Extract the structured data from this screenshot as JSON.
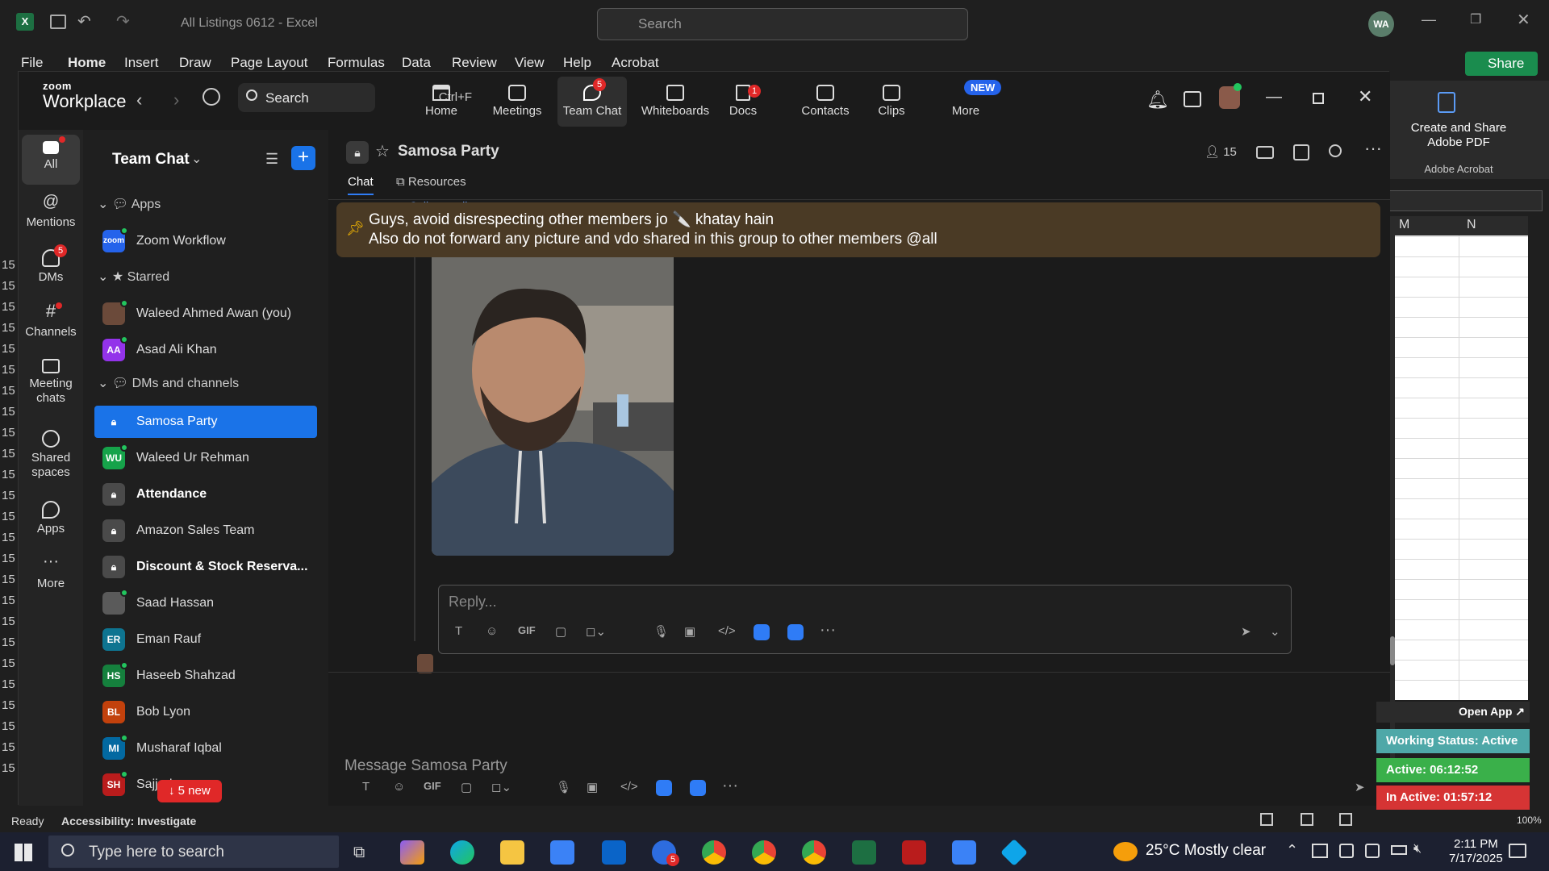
{
  "excel": {
    "title": "All Listings 0612  -  Excel",
    "search_placeholder": "Search",
    "avatar": "WA",
    "share_label": "Share",
    "tabs": [
      "File",
      "Home",
      "Insert",
      "Draw",
      "Page Layout",
      "Formulas",
      "Data",
      "Review",
      "View",
      "Help",
      "Acrobat"
    ],
    "acrobat_create": "Create and Share Adobe PDF",
    "acrobat_group": "Adobe Acrobat",
    "col_m": "M",
    "col_n": "N",
    "row_label": "15",
    "status_ready": "Ready",
    "status_accessibility": "Accessibility: Investigate",
    "zoom_level": "100%"
  },
  "zoom": {
    "logo_top": "zoom",
    "logo_bottom": "Workplace",
    "search_label": "Search",
    "search_shortcut": "Ctrl+F",
    "nav": [
      {
        "label": "Home",
        "icon": "home-icon"
      },
      {
        "label": "Meetings",
        "icon": "camera-icon"
      },
      {
        "label": "Team Chat",
        "icon": "chat-icon",
        "badge": "5"
      },
      {
        "label": "Whiteboards",
        "icon": "whiteboard-icon"
      },
      {
        "label": "Docs",
        "icon": "docs-icon",
        "badge": "1"
      },
      {
        "label": "Contacts",
        "icon": "contacts-icon"
      },
      {
        "label": "Clips",
        "icon": "clips-icon"
      },
      {
        "label": "More",
        "icon": "more-icon",
        "pill": "NEW"
      }
    ],
    "rail": [
      {
        "label": "All",
        "icon": "chat-bubble-icon"
      },
      {
        "label": "Mentions",
        "icon": "at-icon"
      },
      {
        "label": "DMs",
        "icon": "people-icon",
        "badge": "5"
      },
      {
        "label": "Channels",
        "icon": "hash-icon"
      },
      {
        "label": "Meeting chats",
        "icon": "calendar-icon"
      },
      {
        "label": "Shared spaces",
        "icon": "share-icon"
      },
      {
        "label": "Apps",
        "icon": "apps-icon"
      },
      {
        "label": "More",
        "icon": "ellipsis-icon"
      }
    ],
    "sidebar": {
      "title": "Team Chat",
      "sections": {
        "apps": "Apps",
        "starred": "Starred",
        "dms": "DMs and channels"
      },
      "items": [
        {
          "label": "Zoom Workflow",
          "initials": "zoom",
          "color": "#2563eb"
        },
        {
          "label": "Waleed Ahmed Awan (you)",
          "initials": "",
          "color": "#6b4a3a"
        },
        {
          "label": "Asad Ali Khan",
          "initials": "AA",
          "color": "#9333ea"
        },
        {
          "label": "Samosa Party",
          "initials": "",
          "color": "#1a73e8"
        },
        {
          "label": "Waleed Ur Rehman",
          "initials": "WU",
          "color": "#16a34a"
        },
        {
          "label": "Attendance",
          "initials": "",
          "color": "#4a4a4a"
        },
        {
          "label": "Amazon Sales Team",
          "initials": "",
          "color": "#4a4a4a"
        },
        {
          "label": "Discount & Stock Reserva...",
          "initials": "",
          "color": "#4a4a4a"
        },
        {
          "label": "Saad Hassan",
          "initials": "",
          "color": "#5a5a5a"
        },
        {
          "label": "Eman Rauf",
          "initials": "ER",
          "color": "#0e7490"
        },
        {
          "label": "Haseeb Shahzad",
          "initials": "HS",
          "color": "#15803d"
        },
        {
          "label": "Bob Lyon",
          "initials": "BL",
          "color": "#c2410c"
        },
        {
          "label": "Musharaf Iqbal",
          "initials": "MI",
          "color": "#0369a1"
        },
        {
          "label": "Sajjad",
          "initials": "SH",
          "color": "#b91c1c"
        }
      ],
      "new_pill": "↓ 5 new"
    },
    "channel": {
      "name": "Samosa Party",
      "members": "15",
      "tabs": [
        "Chat",
        "Resources"
      ],
      "collapse_all": "Collapse all",
      "pinned_line1": "Guys, avoid disrespecting other members jo 🔪 khatay hain",
      "pinned_line2": "Also do not forward any picture and vdo shared in this group to other members @all",
      "reply_placeholder": "Reply...",
      "message_placeholder": "Message Samosa Party",
      "gif": "GIF"
    }
  },
  "widget": {
    "open_app": "Open App ↗",
    "working_status": "Working Status: Active",
    "active": "Active: 06:12:52",
    "inactive": "In Active: 01:57:12"
  },
  "taskbar": {
    "search_placeholder": "Type here to search",
    "weather": "25°C  Mostly clear",
    "time": "2:11 PM",
    "date": "7/17/2025",
    "teams_badge": "5"
  }
}
